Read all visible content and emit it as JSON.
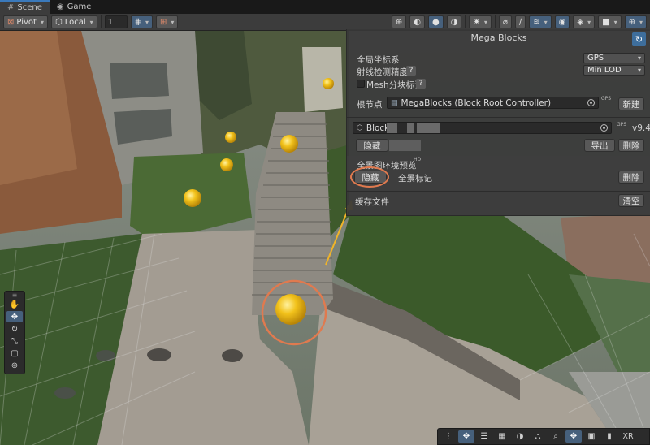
{
  "tabs": [
    {
      "label": "Scene",
      "icon": "hash-icon",
      "active": true
    },
    {
      "label": "Game",
      "icon": "gamepad-icon",
      "active": false
    }
  ],
  "toolbar": {
    "pivot_label": "Pivot",
    "local_label": "Local",
    "grid_value": "1"
  },
  "panel": {
    "title": "Mega Blocks",
    "global_coord_label": "全局坐标系",
    "global_coord_value": "GPS",
    "ray_precision_label": "射线检测精度",
    "ray_precision_value": "Min LOD",
    "help_glyph": "?",
    "mesh_mark_label": "Mesh分块标识",
    "root_node_label": "根节点",
    "root_node_value": "MegaBlocks (Block Root Controller)",
    "gps_tag": "GPS",
    "new_button": "新建",
    "block_name": "Block_",
    "version": "v9.4",
    "hide_button": "隐藏",
    "export_button": "导出",
    "delete_button": "删除",
    "preview_title": "全景图环境预览",
    "hd_tag": "HD",
    "preview_hide_button": "隐藏",
    "panorama_mark_label": "全景标记",
    "preview_delete_button": "删除",
    "cache_label": "缓存文件",
    "clear_button": "清空"
  },
  "bottom_toolbar": {
    "xr_label": "XR"
  },
  "colors": {
    "accent_blue": "#3a79bb",
    "annotation_orange": "#e07a4f",
    "annotation_arrow": "#f0b429",
    "marker_yellow": "#f2c21b"
  }
}
